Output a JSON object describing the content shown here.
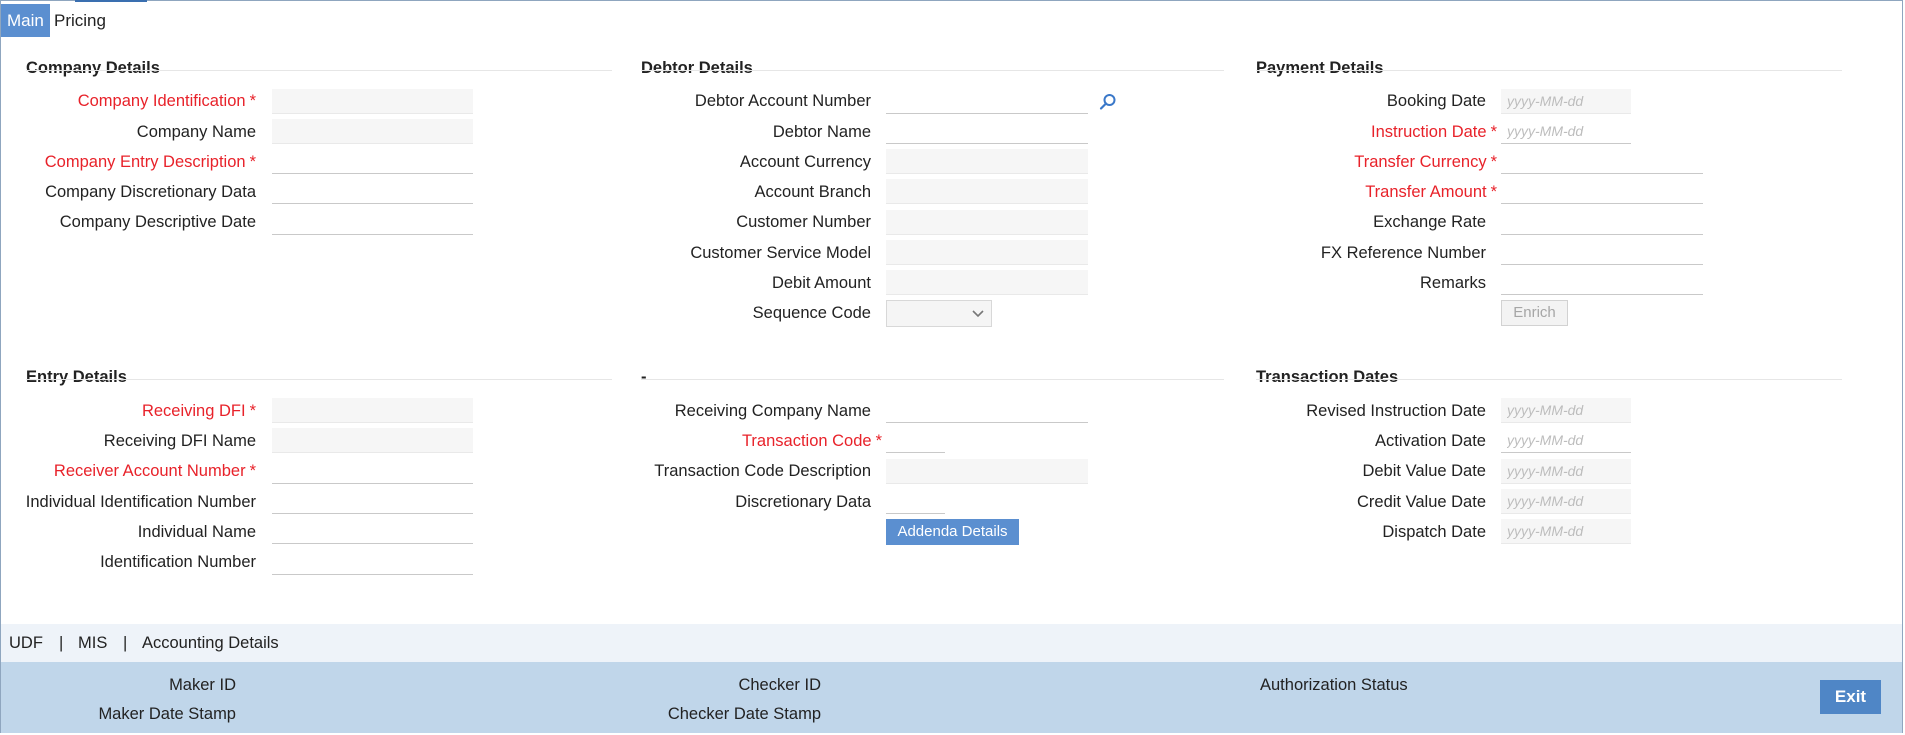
{
  "tabs": [
    {
      "label": "Main",
      "active": true
    },
    {
      "label": "Pricing",
      "active": false
    }
  ],
  "company_details": {
    "title": "Company Details",
    "fields": [
      {
        "label": "Company Identification",
        "required": true,
        "value": ""
      },
      {
        "label": "Company Name",
        "required": false,
        "value": ""
      },
      {
        "label": "Company Entry Description",
        "required": true,
        "value": ""
      },
      {
        "label": "Company Discretionary Data",
        "required": false,
        "value": ""
      },
      {
        "label": "Company Descriptive Date",
        "required": false,
        "value": ""
      }
    ]
  },
  "debtor_details": {
    "title": "Debtor Details",
    "fields": [
      {
        "label": "Debtor Account Number",
        "required": false,
        "value": ""
      },
      {
        "label": "Debtor Name",
        "required": false,
        "value": ""
      },
      {
        "label": "Account Currency",
        "required": false,
        "value": ""
      },
      {
        "label": "Account Branch",
        "required": false,
        "value": ""
      },
      {
        "label": "Customer Number",
        "required": false,
        "value": ""
      },
      {
        "label": "Customer Service Model",
        "required": false,
        "value": ""
      },
      {
        "label": "Debit Amount",
        "required": false,
        "value": ""
      },
      {
        "label": "Sequence Code",
        "required": false,
        "value": ""
      }
    ],
    "lookup_icon": "search-icon"
  },
  "payment_details": {
    "title": "Payment Details",
    "fields": [
      {
        "label": "Booking Date",
        "required": false,
        "placeholder": "yyyy-MM-dd"
      },
      {
        "label": "Instruction Date",
        "required": true,
        "placeholder": "yyyy-MM-dd"
      },
      {
        "label": "Transfer Currency",
        "required": true,
        "value": ""
      },
      {
        "label": "Transfer Amount",
        "required": true,
        "value": ""
      },
      {
        "label": "Exchange Rate",
        "required": false,
        "value": ""
      },
      {
        "label": "FX Reference Number",
        "required": false,
        "value": ""
      },
      {
        "label": "Remarks",
        "required": false,
        "value": ""
      }
    ],
    "enrich_label": "Enrich"
  },
  "entry_details": {
    "title": "Entry Details",
    "fields": [
      {
        "label": "Receiving DFI",
        "required": true,
        "value": ""
      },
      {
        "label": "Receiving DFI Name",
        "required": false,
        "value": ""
      },
      {
        "label": "Receiver Account Number",
        "required": true,
        "value": ""
      },
      {
        "label": "Individual Identification Number",
        "required": false,
        "value": ""
      },
      {
        "label": "Individual Name",
        "required": false,
        "value": ""
      },
      {
        "label": "Identification Number",
        "required": false,
        "value": ""
      }
    ]
  },
  "dash_section": {
    "title": "-",
    "fields": [
      {
        "label": "Receiving Company Name",
        "required": false,
        "value": ""
      },
      {
        "label": "Transaction Code",
        "required": true,
        "value": ""
      },
      {
        "label": "Transaction Code Description",
        "required": false,
        "value": ""
      },
      {
        "label": "Discretionary Data",
        "required": false,
        "value": ""
      }
    ],
    "addenda_label": "Addenda Details"
  },
  "transaction_dates": {
    "title": "Transaction Dates",
    "fields": [
      {
        "label": "Revised Instruction Date",
        "placeholder": "yyyy-MM-dd"
      },
      {
        "label": "Activation Date",
        "placeholder": "yyyy-MM-dd"
      },
      {
        "label": "Debit Value Date",
        "placeholder": "yyyy-MM-dd"
      },
      {
        "label": "Credit Value Date",
        "placeholder": "yyyy-MM-dd"
      },
      {
        "label": "Dispatch Date",
        "placeholder": "yyyy-MM-dd"
      }
    ]
  },
  "links": {
    "udf": "UDF",
    "mis": "MIS",
    "accounting": "Accounting Details",
    "separator": "|"
  },
  "footer": {
    "maker_id": "Maker ID",
    "maker_date_stamp": "Maker Date Stamp",
    "checker_id": "Checker ID",
    "checker_date_stamp": "Checker Date Stamp",
    "authorization_status": "Authorization Status",
    "exit_label": "Exit"
  },
  "colors": {
    "accent": "#5b8fd0",
    "required": "#e8222a",
    "footer_bg": "#c0d6ea"
  }
}
